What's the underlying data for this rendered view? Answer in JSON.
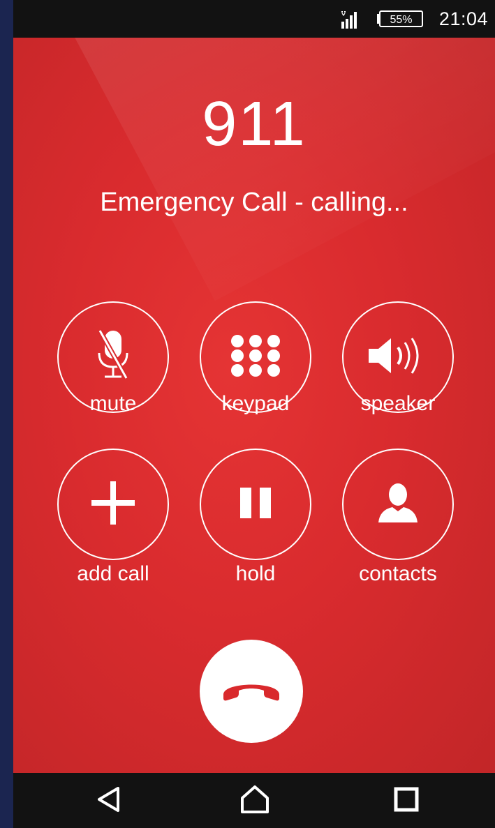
{
  "status_bar": {
    "battery": "55%",
    "time": "21:04"
  },
  "call": {
    "number": "911",
    "status": "Emergency Call - calling..."
  },
  "controls": {
    "mute": "mute",
    "keypad": "keypad",
    "speaker": "speaker",
    "add_call": "add call",
    "hold": "hold",
    "contacts": "contacts"
  },
  "icons": {
    "mute": "microphone-off-icon",
    "keypad": "dialpad-icon",
    "speaker": "speaker-volume-icon",
    "add_call": "plus-icon",
    "hold": "pause-icon",
    "contacts": "person-icon",
    "end_call": "phone-hangup-icon",
    "back": "triangle-back-icon",
    "home": "house-icon",
    "recents": "square-recents-icon"
  },
  "colors": {
    "background_red": "#d92b2e",
    "end_call_icon": "#d9292c",
    "bars": "#121212",
    "foreground": "#ffffff"
  }
}
